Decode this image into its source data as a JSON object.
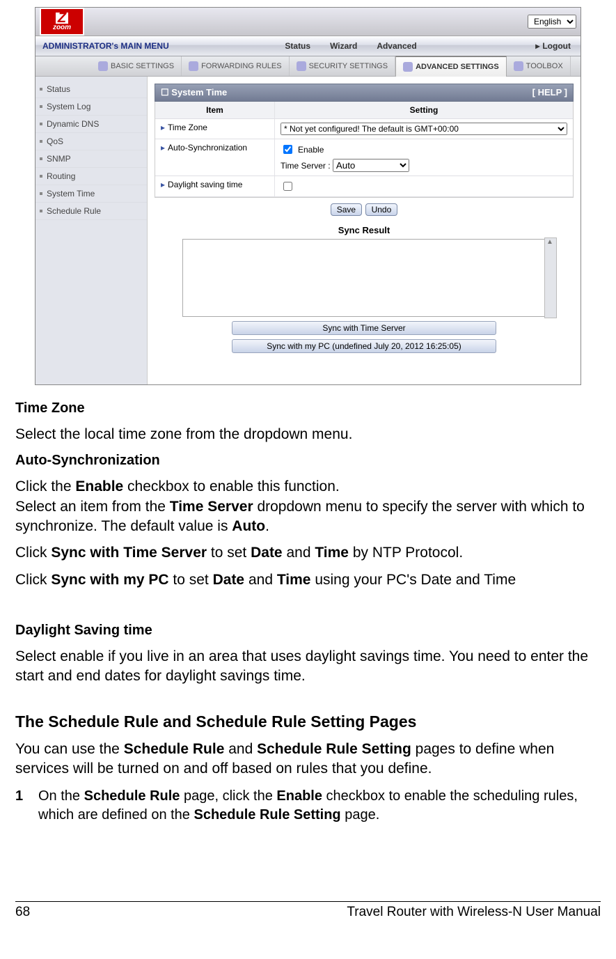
{
  "ui": {
    "language": "English",
    "mainMenu": {
      "admin": "ADMINISTRATOR's MAIN MENU",
      "status": "Status",
      "wizard": "Wizard",
      "advanced": "Advanced",
      "logout": "Logout"
    },
    "subTabs": {
      "basic": "BASIC SETTINGS",
      "fwd": "FORWARDING RULES",
      "sec": "SECURITY SETTINGS",
      "adv": "ADVANCED SETTINGS",
      "tool": "TOOLBOX"
    },
    "sidebar": [
      "Status",
      "System Log",
      "Dynamic DNS",
      "QoS",
      "SNMP",
      "Routing",
      "System Time",
      "Schedule Rule"
    ],
    "panel": {
      "title": "System Time",
      "help": "[ HELP ]",
      "itemHdr": "Item",
      "settingHdr": "Setting",
      "timeZone": "Time Zone",
      "tzValue": "* Not yet configured! The default is GMT+00:00",
      "autoSync": "Auto-Synchronization",
      "enable": "Enable",
      "timeServerLbl": "Time Server :",
      "timeServerVal": "Auto",
      "dst": "Daylight saving time",
      "save": "Save",
      "undo": "Undo",
      "syncResult": "Sync Result",
      "btnSyncServer": "Sync with Time Server",
      "btnSyncPC": "Sync with my PC (undefined July 20, 2012 16:25:05)"
    }
  },
  "doc": {
    "timeZone": {
      "term": "Time Zone",
      "body": "Select the local time zone from the dropdown menu."
    },
    "autoSync": {
      "term": "Auto-Synchronization",
      "line1a": "Click the ",
      "line1b": "Enable",
      "line1c": " checkbox to enable this function.",
      "line2a": "Select an item from the ",
      "line2b": "Time Server",
      "line2c": " dropdown menu to specify the server with which to synchronize. The default value is ",
      "line2d": "Auto",
      "line2e": "."
    },
    "sync1": {
      "a": "Click ",
      "b": "Sync with Time Server",
      "c": " to set ",
      "d": "Date",
      "e": " and ",
      "f": "Time",
      "g": " by NTP Protocol."
    },
    "sync2": {
      "a": "Click ",
      "b": "Sync with my PC",
      "c": " to set ",
      "d": "Date",
      "e": " and ",
      "f": "Time",
      "g": " using your PC's Date and Time"
    },
    "dst": {
      "term": "Daylight Saving time",
      "body": "Select enable if you live in an area that uses daylight savings time. You need to enter the start and end dates for daylight savings time."
    },
    "section": {
      "heading": "The Schedule Rule and Schedule Rule Setting Pages",
      "introA": "You can use the ",
      "introB": "Schedule Rule",
      "introC": " and ",
      "introD": "Schedule Rule Setting",
      "introE": " pages to define when services will be turned on and off based on rules that you define.",
      "step1num": "1",
      "step1a": "On the ",
      "step1b": "Schedule Rule",
      "step1c": " page, click the ",
      "step1d": "Enable",
      "step1e": " checkbox to enable the scheduling rules, which are defined on the ",
      "step1f": "Schedule Rule Setting",
      "step1g": " page."
    },
    "footer": {
      "page": "68",
      "title": "Travel Router with Wireless-N User Manual"
    }
  }
}
